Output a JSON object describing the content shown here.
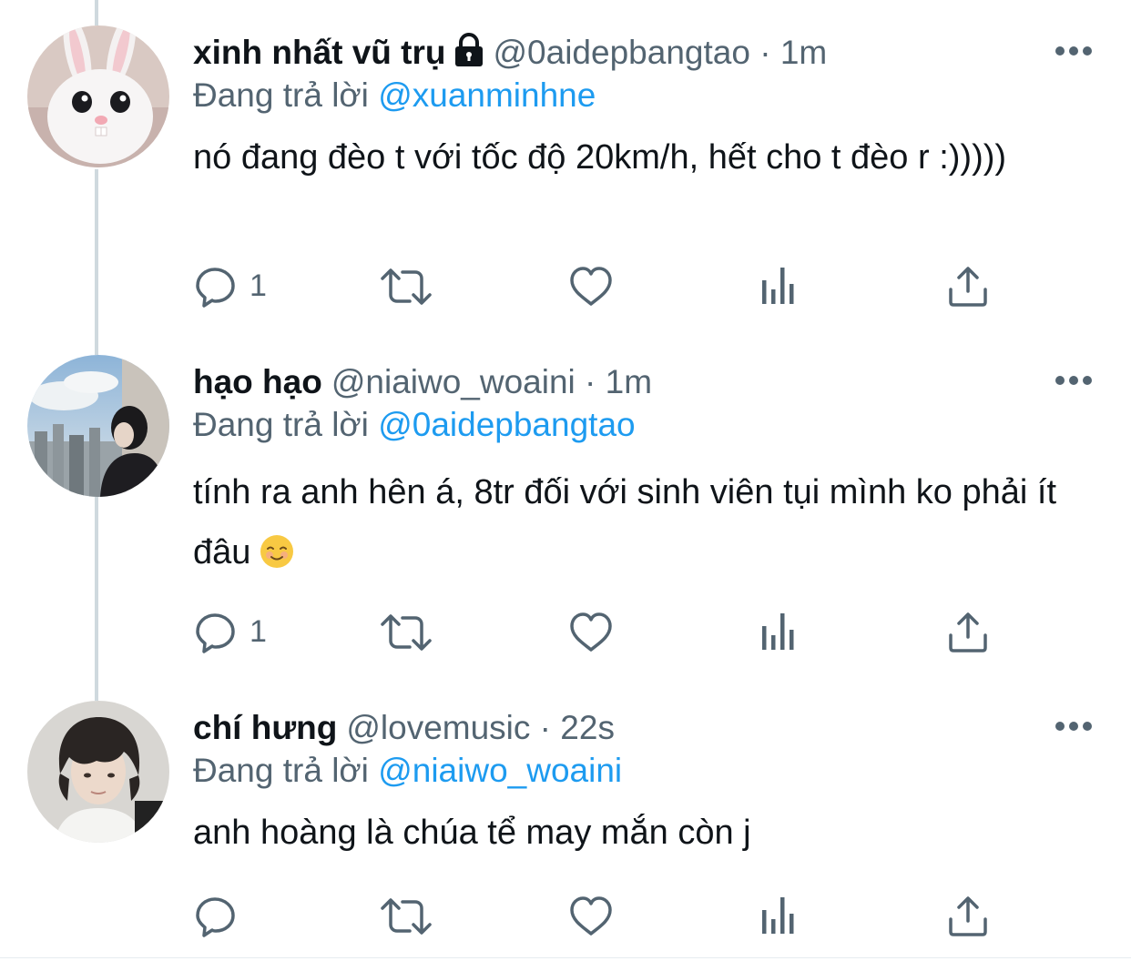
{
  "tweets": [
    {
      "display_name": "xinh nhất vũ trụ",
      "handle": "@0aidepbangtao",
      "separator": " · ",
      "time": "1m",
      "locked": true,
      "reply_prefix": "Đang trả lời",
      "reply_to": "@xuanminhne",
      "text": "nó đang đèo t với tốc độ 20km/h, hết cho t đèo r :)))))",
      "reply_count": "1",
      "avatar_icon": "white-rabbit-avatar"
    },
    {
      "display_name": "hạo hạo",
      "handle": "@niaiwo_woaini",
      "separator": " · ",
      "time": "1m",
      "locked": false,
      "reply_prefix": "Đang trả lời",
      "reply_to": "@0aidepbangtao",
      "text": "tính ra anh hên á, 8tr đối với sinh viên tụi mình ko phải ít đâu",
      "emoji": "smiling-face-emoji",
      "reply_count": "1",
      "avatar_icon": "person-city-sky-avatar"
    },
    {
      "display_name": "chí hưng",
      "handle": "@lovemusic",
      "separator": " · ",
      "time": "22s",
      "locked": false,
      "reply_prefix": "Đang trả lời",
      "reply_to": "@niaiwo_woaini",
      "text": "anh hoàng là chúa tể may mắn còn j",
      "reply_count": "",
      "avatar_icon": "person-curly-hair-avatar"
    }
  ],
  "colors": {
    "primary_text": "#0f1419",
    "secondary_text": "#536471",
    "link": "#1d9bf0",
    "thread_line": "#cfd9de"
  },
  "icons": [
    "reply-icon",
    "retweet-icon",
    "like-icon",
    "analytics-icon",
    "share-icon",
    "more-icon",
    "lock-icon"
  ]
}
